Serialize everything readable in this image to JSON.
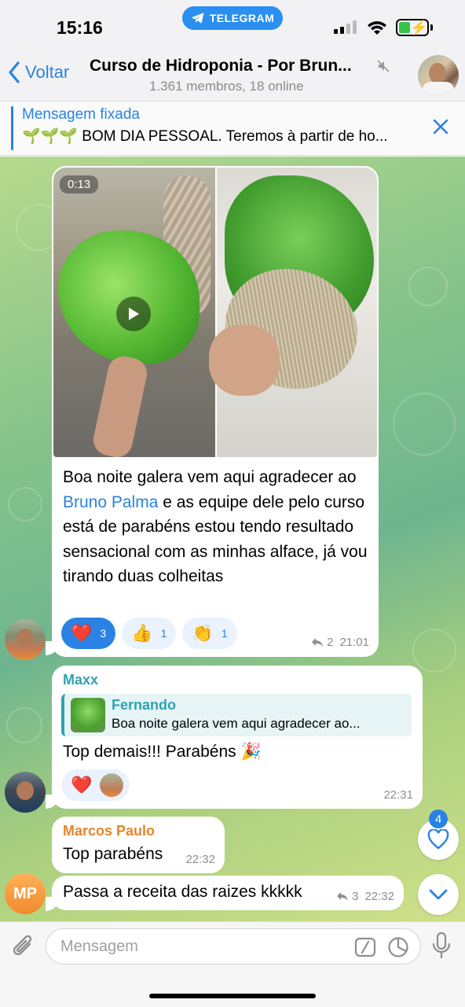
{
  "status_bar": {
    "time": "15:16",
    "app_pill": "TELEGRAM"
  },
  "header": {
    "back_label": "Voltar",
    "title": "Curso de Hidroponia - Por Brun...",
    "subtitle": "1.361 membros, 18 online"
  },
  "pinned": {
    "title": "Mensagem fixada",
    "emoji": "🌱🌱🌱",
    "text": "BOM DIA PESSOAL. Teremos à partir de ho..."
  },
  "messages": [
    {
      "duration": "0:13",
      "text_before": "Boa noite galera vem aqui agradecer ao ",
      "mention": "Bruno Palma",
      "text_after": " e as equipe dele pelo curso está de parabéns estou tendo resultado sensacional com as minhas alface, já vou tirando duas colheitas",
      "reactions": [
        {
          "emoji": "❤️",
          "count": "3"
        },
        {
          "emoji": "👍",
          "count": "1"
        },
        {
          "emoji": "👏",
          "count": "1"
        }
      ],
      "replies": "2",
      "time": "21:01"
    },
    {
      "sender": "Maxx",
      "reply_name": "Fernando",
      "reply_text": "Boa noite galera vem aqui agradecer ao...",
      "text": "Top demais!!! Parabéns 🎉",
      "reaction": "❤️",
      "time": "22:31"
    },
    {
      "sender": "Marcos Paulo",
      "text": "Top parabéns",
      "time": "22:32"
    },
    {
      "avatar_initials": "MP",
      "text": "Passa a receita das raizes kkkkk",
      "replies": "3",
      "time": "22:32"
    }
  ],
  "side": {
    "reactions_badge": "4"
  },
  "input": {
    "placeholder": "Mensagem"
  },
  "colors": {
    "accent": "#2a82e4",
    "maxx": "#2fa2b5",
    "marcos": "#e8842a"
  }
}
